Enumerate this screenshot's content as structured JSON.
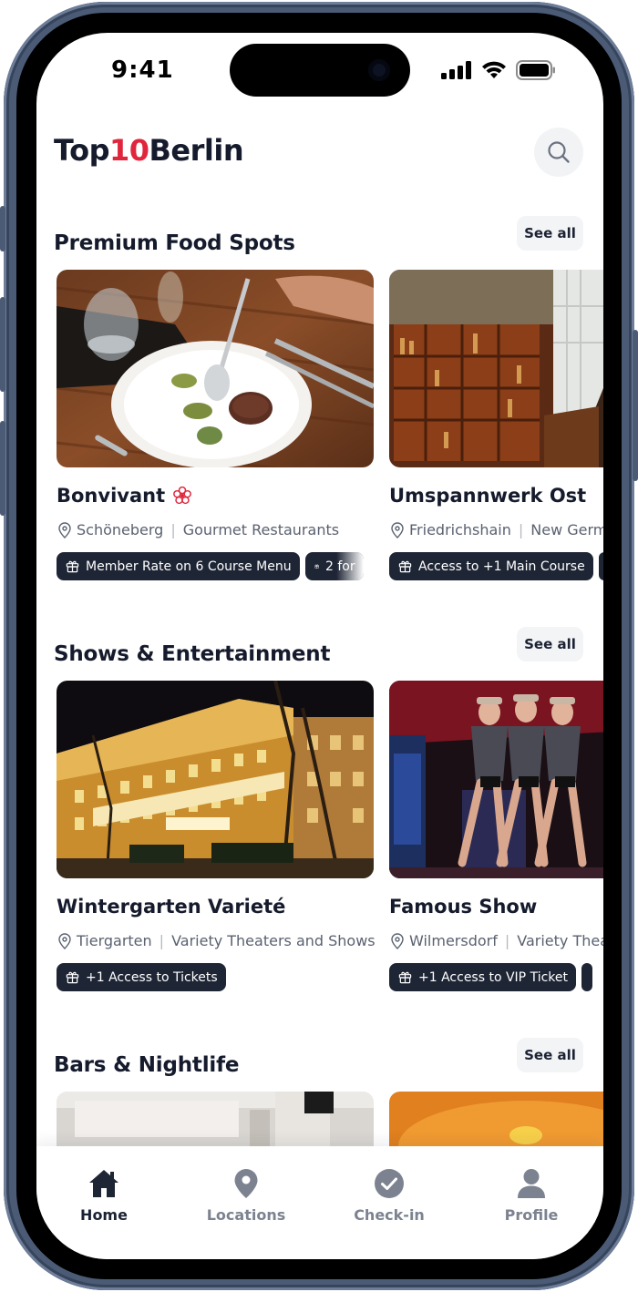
{
  "status_bar": {
    "time": "9:41"
  },
  "header": {
    "brand_prefix": "Top",
    "brand_accent": "10",
    "brand_suffix": "Berlin"
  },
  "sections": [
    {
      "title": "Premium Food Spots",
      "see_all": "See all",
      "cards": [
        {
          "name": "Bonvivant",
          "location": "Schöneberg",
          "category": "Gourmet Restaurants",
          "tags": [
            "Member Rate on 6 Course Menu",
            "2 for"
          ]
        },
        {
          "name": "Umspannwerk Ost",
          "location": "Friedrichshain",
          "category": "New Germ",
          "tags": [
            "Access to +1 Main Course"
          ]
        }
      ]
    },
    {
      "title": "Shows & Entertainment",
      "see_all": "See all",
      "cards": [
        {
          "name": "Wintergarten Varieté",
          "location": "Tiergarten",
          "category": "Variety Theaters and Shows",
          "tags": [
            "+1 Access to Tickets"
          ]
        },
        {
          "name": "Famous Show",
          "location": "Wilmersdorf",
          "category": "Variety Thea",
          "tags": [
            "+1 Access to VIP Ticket"
          ]
        }
      ]
    },
    {
      "title": "Bars & Nightlife",
      "see_all": "See all"
    }
  ],
  "bottom_nav": [
    {
      "label": "Home",
      "icon": "home-icon",
      "active": true
    },
    {
      "label": "Locations",
      "icon": "map-pin-icon",
      "active": false
    },
    {
      "label": "Check-in",
      "icon": "check-circle-icon",
      "active": false
    },
    {
      "label": "Profile",
      "icon": "user-icon",
      "active": false
    }
  ],
  "colors": {
    "brand_accent": "#e0263c",
    "tag_background": "#1e2535",
    "text_primary": "#151b2c",
    "text_muted": "#5a6170",
    "nav_inactive": "#7c8290"
  }
}
